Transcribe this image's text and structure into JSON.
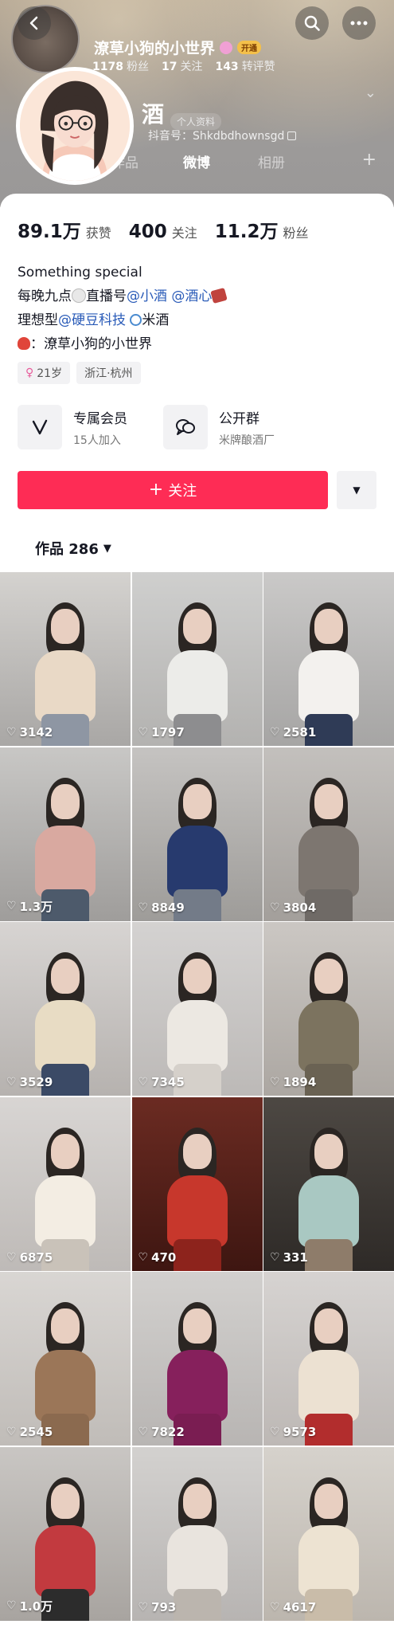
{
  "header": {
    "name": "潦草小狗的小世界",
    "open_badge": "开通",
    "mini_stats": [
      {
        "value": "1178",
        "label": "粉丝"
      },
      {
        "value": "17",
        "label": "关注"
      },
      {
        "value": "143",
        "label": "转评赞"
      }
    ],
    "ghost_name": "酒",
    "ghost_tag": "个人资料",
    "douyin_id": "抖音号：Shkdbdhownsgd",
    "ghost_tabs": [
      "作品",
      "微博",
      "相册"
    ]
  },
  "stats": [
    {
      "value": "89.1万",
      "label": "获赞"
    },
    {
      "value": "400",
      "label": "关注"
    },
    {
      "value": "11.2万",
      "label": "粉丝"
    }
  ],
  "bio": {
    "line1": "Something special",
    "line2_a": "每晚九点",
    "line2_b": "直播号",
    "line2_link1": "@小酒",
    "line2_link2": "@酒心",
    "line3_a": "理想型",
    "line3_link": "@硬豆科技",
    "line3_b": "米酒",
    "line4": "：潦草小狗的小世界"
  },
  "tags": {
    "age": "21岁",
    "location": "浙江·杭州"
  },
  "features": {
    "member_title": "专属会员",
    "member_sub": "15人加入",
    "group_title": "公开群",
    "group_sub": "米牌酿酒厂"
  },
  "follow_button": "关注",
  "works_tab": "作品 286",
  "videos": [
    {
      "likes": "3142",
      "top": "#d4d2cf",
      "bottom": "#a9a7a5",
      "outfit": "#e9d9c6",
      "pants": "#8e96a3"
    },
    {
      "likes": "1797",
      "top": "#cfcfce",
      "bottom": "#b3b2b0",
      "outfit": "#ecece9",
      "pants": "#8d8d8f"
    },
    {
      "likes": "2581",
      "top": "#cac9c8",
      "bottom": "#a6a5a4",
      "outfit": "#f3f1ee",
      "pants": "#2f3b56"
    },
    {
      "likes": "1.3万",
      "top": "#c8c7c5",
      "bottom": "#9f9d9b",
      "outfit": "#d9a9a0",
      "pants": "#4d5a6b"
    },
    {
      "likes": "8849",
      "top": "#c5c3c1",
      "bottom": "#9e9c99",
      "outfit": "#273a6e",
      "pants": "#737b88"
    },
    {
      "likes": "3804",
      "top": "#c3c0bd",
      "bottom": "#a39f9b",
      "outfit": "#7d7670",
      "pants": "#6f6a66"
    },
    {
      "likes": "3529",
      "top": "#d7d4d2",
      "bottom": "#b6b2af",
      "outfit": "#e8dcc4",
      "pants": "#3b4a66"
    },
    {
      "likes": "7345",
      "top": "#d4d2d1",
      "bottom": "#bcb9b7",
      "outfit": "#ece8e2",
      "pants": "#d5d0ca"
    },
    {
      "likes": "1894",
      "top": "#cbc7c3",
      "bottom": "#aca7a2",
      "outfit": "#7c735f",
      "pants": "#6a6253"
    },
    {
      "likes": "6875",
      "top": "#d8d5d3",
      "bottom": "#bebab7",
      "outfit": "#f3ede3",
      "pants": "#c9c2b9"
    },
    {
      "likes": "470",
      "top": "#6b2b22",
      "bottom": "#3e1611",
      "outfit": "#c7372c",
      "pants": "#8d231c"
    },
    {
      "likes": "331",
      "top": "#4d4843",
      "bottom": "#2e2a27",
      "outfit": "#a9c8c2",
      "pants": "#8e7c6a"
    },
    {
      "likes": "2545",
      "top": "#d9d6d3",
      "bottom": "#c0bcb8",
      "outfit": "#9b7658",
      "pants": "#8b6a4f"
    },
    {
      "likes": "7822",
      "top": "#d2d0ce",
      "bottom": "#b8b5b3",
      "outfit": "#86205c",
      "pants": "#7a1d52"
    },
    {
      "likes": "9573",
      "top": "#d6d3d1",
      "bottom": "#bdb8b5",
      "outfit": "#ece1d2",
      "pants": "#b22d2d"
    },
    {
      "likes": "1.0万",
      "top": "#c9c6c3",
      "bottom": "#a8a4a0",
      "outfit": "#c23a3f",
      "pants": "#2c2c2c"
    },
    {
      "likes": "793",
      "top": "#d3d1cf",
      "bottom": "#b7b4b2",
      "outfit": "#e9e4de",
      "pants": "#bbb5ae"
    },
    {
      "likes": "4617",
      "top": "#d6d2cc",
      "bottom": "#bcb6ae",
      "outfit": "#ede3d2",
      "pants": "#c9bca9"
    }
  ]
}
